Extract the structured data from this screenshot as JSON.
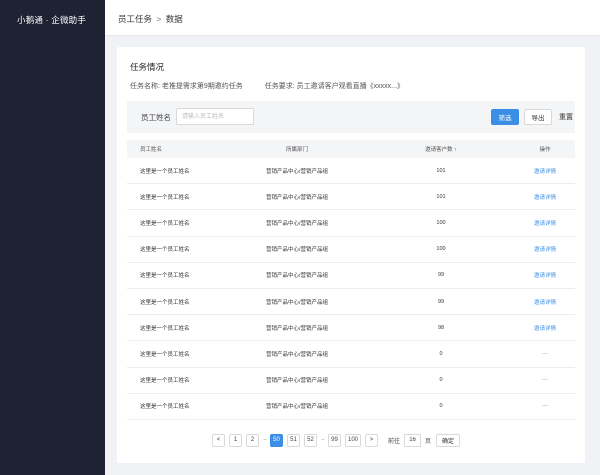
{
  "app": {
    "title": "小鹅通 · 企微助手"
  },
  "breadcrumb": {
    "parent": "员工任务",
    "separator": ">",
    "current": "数据"
  },
  "section": {
    "title": "任务情况",
    "task_name": "任务名称: 老推提需求第9期邀约任务",
    "task_req": "任务要求: 员工邀请客户观看直播《xxxxx...》"
  },
  "filter": {
    "label": "员工姓名",
    "placeholder": "请输入员工姓名",
    "filter_btn": "筛选",
    "export_btn": "导出",
    "reset_btn": "重置"
  },
  "table": {
    "columns": [
      "员工姓名",
      "所属部门",
      "邀请客户数 ↑",
      "操作"
    ],
    "rows": [
      {
        "name": "这里是一个员工姓名",
        "dept": "营销产品中心/营销产品组",
        "count": "101",
        "action": "邀请详情"
      },
      {
        "name": "这里是一个员工姓名",
        "dept": "营销产品中心/营销产品组",
        "count": "101",
        "action": "邀请详情"
      },
      {
        "name": "这里是一个员工姓名",
        "dept": "营销产品中心/营销产品组",
        "count": "100",
        "action": "邀请详情"
      },
      {
        "name": "这里是一个员工姓名",
        "dept": "营销产品中心/营销产品组",
        "count": "100",
        "action": "邀请详情"
      },
      {
        "name": "这里是一个员工姓名",
        "dept": "营销产品中心/营销产品组",
        "count": "99",
        "action": "邀请详情"
      },
      {
        "name": "这里是一个员工姓名",
        "dept": "营销产品中心/营销产品组",
        "count": "99",
        "action": "邀请详情"
      },
      {
        "name": "这里是一个员工姓名",
        "dept": "营销产品中心/营销产品组",
        "count": "98",
        "action": "邀请详情"
      },
      {
        "name": "这里是一个员工姓名",
        "dept": "营销产品中心/营销产品组",
        "count": "0",
        "action": "—"
      },
      {
        "name": "这里是一个员工姓名",
        "dept": "营销产品中心/营销产品组",
        "count": "0",
        "action": "—"
      },
      {
        "name": "这里是一个员工姓名",
        "dept": "营销产品中心/营销产品组",
        "count": "0",
        "action": "—"
      }
    ]
  },
  "pagination": {
    "prev": "<",
    "next": ">",
    "ellipsis": "···",
    "pages_left": [
      "1",
      "2"
    ],
    "pages_mid": [
      "50",
      "51",
      "52"
    ],
    "active": "50",
    "pages_right": [
      "99",
      "100"
    ],
    "goto_label": "前往",
    "goto_value": "16",
    "goto_unit": "页",
    "confirm": "确定"
  },
  "colors": {
    "sidebar": "#1f2233",
    "accent": "#3a8ee6"
  }
}
